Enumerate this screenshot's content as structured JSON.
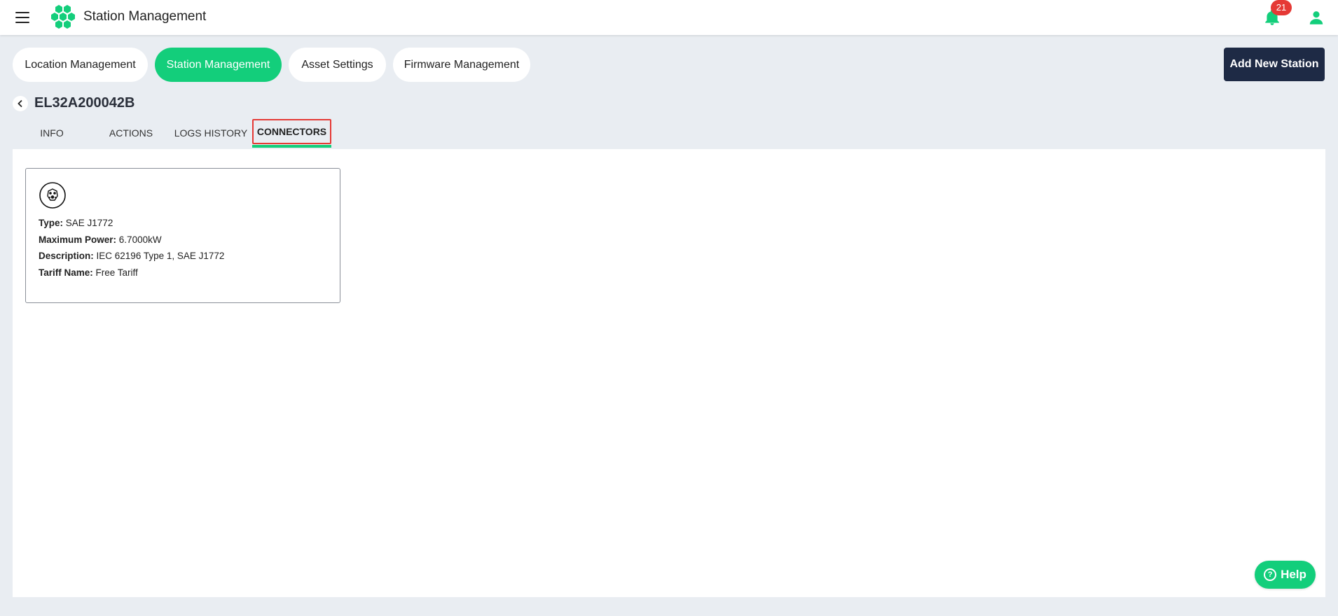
{
  "header": {
    "app_title": "Station Management",
    "notification_count": "21"
  },
  "nav": {
    "pills": [
      {
        "label": "Location Management"
      },
      {
        "label": "Station Management",
        "active": true
      },
      {
        "label": "Asset Settings"
      },
      {
        "label": "Firmware Management"
      }
    ],
    "add_button": "Add New Station"
  },
  "station": {
    "id": "EL32A200042B"
  },
  "tabs": [
    {
      "label": "INFO"
    },
    {
      "label": "ACTIONS"
    },
    {
      "label": "LOGS HISTORY"
    },
    {
      "label": "CONNECTORS",
      "active": true
    }
  ],
  "connector": {
    "icon": "connector-icon",
    "type_label": "Type:",
    "type_value": "SAE J1772",
    "power_label": "Maximum Power:",
    "power_value": "6.7000kW",
    "description_label": "Description:",
    "description_value": "IEC 62196 Type 1, SAE J1772",
    "tariff_label": "Tariff Name:",
    "tariff_value": "Free Tariff"
  },
  "help": {
    "label": "Help",
    "icon_glyph": "?"
  },
  "colors": {
    "accent": "#13ce7b",
    "primary_dark": "#1e2a45",
    "badge": "#e53935",
    "background": "#e9edf2"
  }
}
